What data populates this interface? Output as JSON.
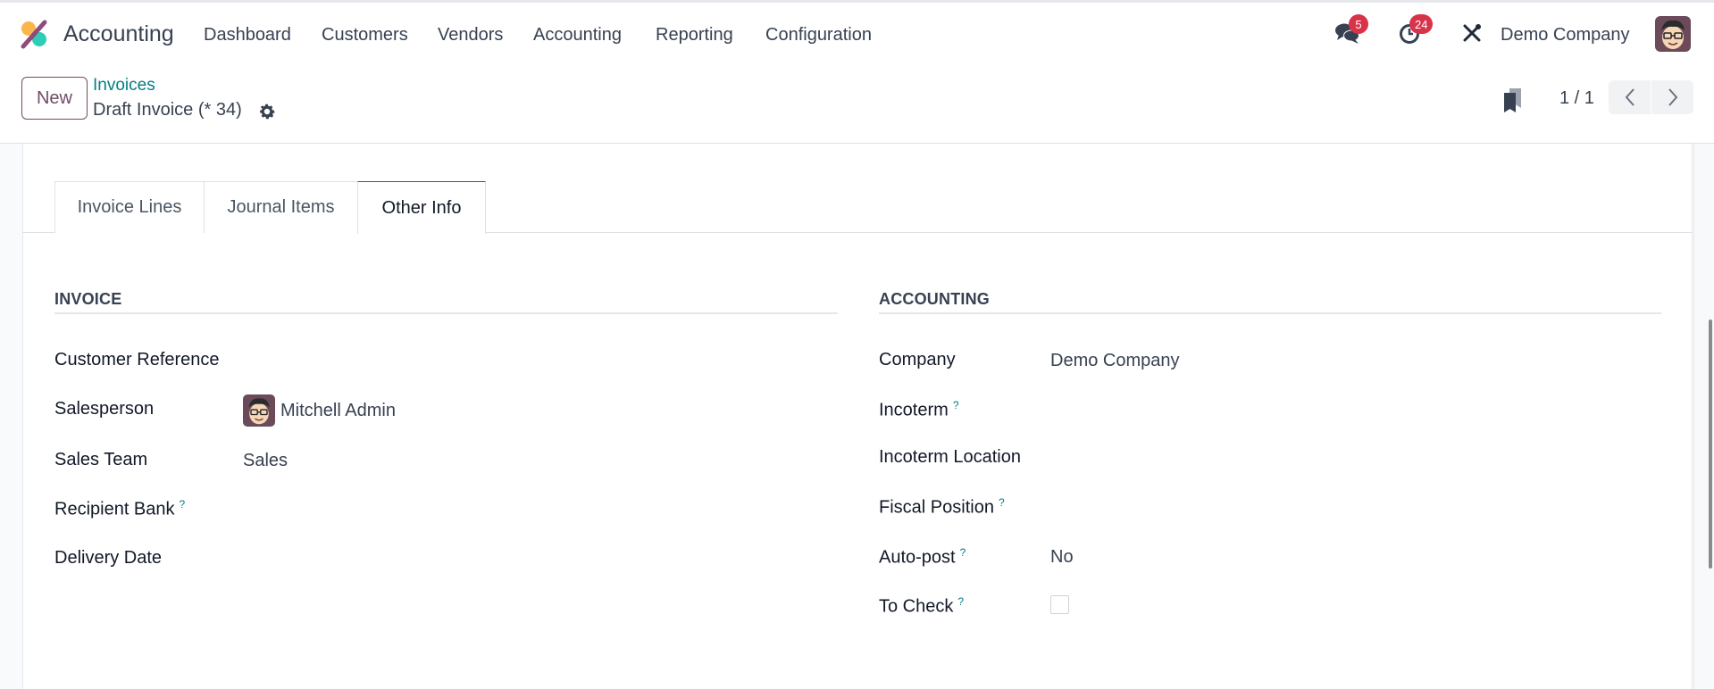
{
  "navbar": {
    "app_name": "Accounting",
    "menu": [
      "Dashboard",
      "Customers",
      "Vendors",
      "Accounting",
      "Reporting",
      "Configuration"
    ],
    "messages_count": "5",
    "activities_count": "24",
    "company": "Demo Company",
    "icons": {
      "app_logo": "accounting-logo-icon",
      "messages": "chat-bubbles-icon",
      "activities": "clock-icon",
      "tools": "wrench-screwdriver-icon",
      "user": "user-avatar"
    }
  },
  "control_panel": {
    "new_label": "New",
    "breadcrumb_parent": "Invoices",
    "breadcrumb_current": "Draft Invoice (* 34)",
    "pager_value": "1 / 1",
    "icons": {
      "settings": "gear-icon",
      "bookmark": "bookmark-icon",
      "prev": "chevron-left-icon",
      "next": "chevron-right-icon"
    }
  },
  "tabs": [
    {
      "label": "Invoice Lines",
      "active": false
    },
    {
      "label": "Journal Items",
      "active": false
    },
    {
      "label": "Other Info",
      "active": true
    }
  ],
  "invoice_group": {
    "title": "INVOICE",
    "fields": [
      {
        "label": "Customer Reference",
        "value": "",
        "help": false
      },
      {
        "label": "Salesperson",
        "value": "Mitchell Admin",
        "help": false
      },
      {
        "label": "Sales Team",
        "value": "Sales",
        "help": false
      },
      {
        "label": "Recipient Bank",
        "value": "",
        "help": true
      },
      {
        "label": "Delivery Date",
        "value": "",
        "help": false
      }
    ]
  },
  "accounting_group": {
    "title": "ACCOUNTING",
    "fields": [
      {
        "label": "Company",
        "value": "Demo Company",
        "help": false
      },
      {
        "label": "Incoterm",
        "value": "",
        "help": true
      },
      {
        "label": "Incoterm Location",
        "value": "",
        "help": false
      },
      {
        "label": "Fiscal Position",
        "value": "",
        "help": true
      },
      {
        "label": "Auto-post",
        "value": "No",
        "help": true
      },
      {
        "label": "To Check",
        "value": false,
        "help": true
      }
    ]
  },
  "help_marker": "?",
  "colors": {
    "brand": "#714b67",
    "link": "#017e84",
    "badge": "#d9334a"
  }
}
